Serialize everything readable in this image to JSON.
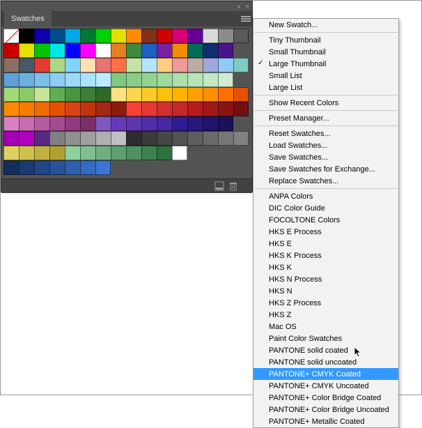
{
  "panel": {
    "title": "Swatches"
  },
  "swatch_rows": [
    [
      "none",
      "#000000",
      "#0c00ad",
      "#004c8c",
      "#00a8e8",
      "#007a33",
      "#00d100",
      "#e3e000",
      "#ff8c00",
      "#7f311a",
      "#d00000",
      "#d80073",
      "#660099",
      "#dadada",
      "#8c8c8c",
      "#5a5a5a"
    ],
    [
      "#c80000",
      "#e2e200",
      "#00c400",
      "#00e7e7",
      "#0000ff",
      "#ff00ff",
      "#ffffff",
      "#e67e22",
      "#3a8a3a",
      "#1f5fbf",
      "#7b1fa2",
      "#ef8e00",
      "#006d5b",
      "#0f2e6e",
      "#4a148c"
    ],
    [
      "#8d6e63",
      "#455a64",
      "#e53935",
      "#aed581",
      "#81d4fa",
      "#ffe0b2",
      "#e57373",
      "#ff7043",
      "#c5e1a5",
      "#b3e5fc",
      "#ffcc80",
      "#ef9a9a",
      "#bcaaa4",
      "#9fa8da",
      "#90caf9",
      "#80cbc4"
    ],
    [
      "#5da1d6",
      "#6cb0e0",
      "#7cbfe9",
      "#8ccdf1",
      "#9cd9f8",
      "#abe3fe",
      "#b9ecff",
      "#7fc97f",
      "#88ce88",
      "#93d493",
      "#9fda9f",
      "#abdfab",
      "#b7e4b7",
      "#c3e9c3",
      "#cfeecf"
    ],
    [
      "#a3d977",
      "#8cc96a",
      "#c6e59b",
      "#5fae52",
      "#4a9540",
      "#3b7f33",
      "#2e6928",
      "#ffe082",
      "#ffd54f",
      "#ffca28",
      "#ffc107",
      "#ffb300",
      "#ffa000",
      "#ff8f00",
      "#ff6f00",
      "#e65100"
    ],
    [
      "#fb8c00",
      "#f57c00",
      "#ef6c00",
      "#e65100",
      "#d84315",
      "#bf360c",
      "#a52714",
      "#8d1b0b",
      "#f44336",
      "#e53935",
      "#d32f2f",
      "#c62828",
      "#b71c1c",
      "#a01818",
      "#891414",
      "#721010"
    ],
    [
      "#d97fc3",
      "#c86db2",
      "#b65ba1",
      "#a44a91",
      "#933980",
      "#7c2e6b",
      "#7e57c2",
      "#673ab7",
      "#5e35b1",
      "#512da8",
      "#4527a0",
      "#311b92",
      "#2a1780",
      "#23136e",
      "#1c0f5c"
    ],
    [
      "#a500b5",
      "#b000c2",
      "#5a2a82",
      "#808080",
      "#909090",
      "#a0a0a0",
      "#b0b0b0",
      "#c0c0c0",
      "#2e2e2e",
      "#3a3a3a",
      "#464646",
      "#525252",
      "#5e5e5e",
      "#6a6a6a",
      "#767676",
      "#828282"
    ],
    [
      "#e0d060",
      "#d0c050",
      "#c0b040",
      "#b0a030",
      "#90cfa0",
      "#80c090",
      "#6fb080",
      "#5fa070",
      "#4f9060",
      "#3f8050",
      "#2f7040",
      "#ffffff"
    ],
    [
      "#142f5c",
      "#1a3a70",
      "#214684",
      "#285298",
      "#2f5eac",
      "#3669c0",
      "#3d75d4"
    ]
  ],
  "menu": {
    "groups": [
      [
        {
          "label": "New Swatch..."
        }
      ],
      [
        {
          "label": "Tiny Thumbnail"
        },
        {
          "label": "Small Thumbnail"
        },
        {
          "label": "Large Thumbnail",
          "checked": true
        },
        {
          "label": "Small List"
        },
        {
          "label": "Large List"
        }
      ],
      [
        {
          "label": "Show Recent Colors"
        }
      ],
      [
        {
          "label": "Preset Manager..."
        }
      ],
      [
        {
          "label": "Reset Swatches..."
        },
        {
          "label": "Load Swatches..."
        },
        {
          "label": "Save Swatches..."
        },
        {
          "label": "Save Swatches for Exchange..."
        },
        {
          "label": "Replace Swatches..."
        }
      ],
      [
        {
          "label": "ANPA Colors"
        },
        {
          "label": "DIC Color Guide"
        },
        {
          "label": "FOCOLTONE Colors"
        },
        {
          "label": "HKS E Process"
        },
        {
          "label": "HKS E"
        },
        {
          "label": "HKS K Process"
        },
        {
          "label": "HKS K"
        },
        {
          "label": "HKS N Process"
        },
        {
          "label": "HKS N"
        },
        {
          "label": "HKS Z Process"
        },
        {
          "label": "HKS Z"
        },
        {
          "label": "Mac OS"
        },
        {
          "label": "Paint Color Swatches"
        },
        {
          "label": "PANTONE solid coated"
        },
        {
          "label": "PANTONE solid uncoated"
        },
        {
          "label": "PANTONE+ CMYK Coated",
          "highlight": true
        },
        {
          "label": "PANTONE+ CMYK Uncoated"
        },
        {
          "label": "PANTONE+ Color Bridge Coated"
        },
        {
          "label": "PANTONE+ Color Bridge Uncoated"
        },
        {
          "label": "PANTONE+ Metallic Coated"
        }
      ]
    ]
  }
}
